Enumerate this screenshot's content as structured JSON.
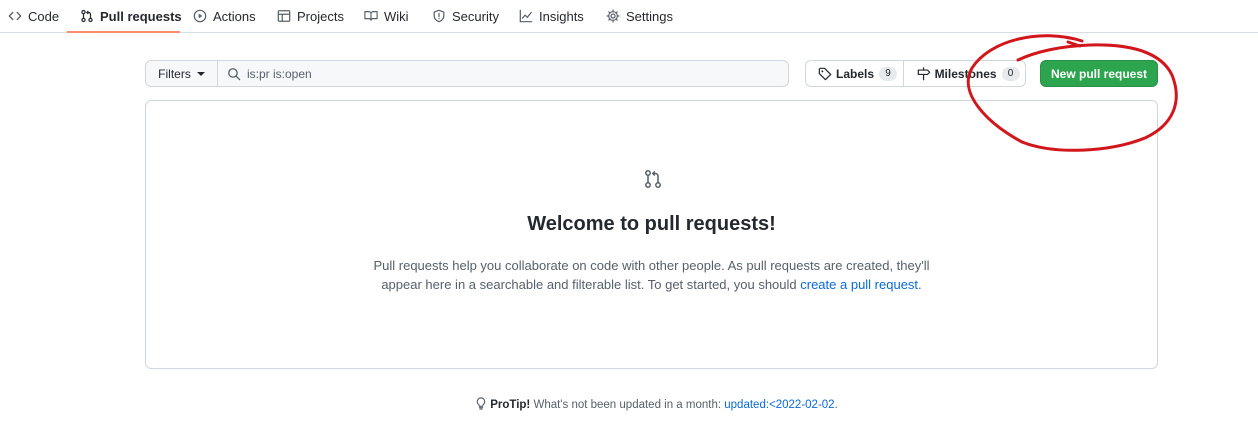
{
  "repo_nav": {
    "items": [
      {
        "label": "Code",
        "icon": "code-icon"
      },
      {
        "label": "Pull requests",
        "icon": "git-pull-request-icon"
      },
      {
        "label": "Actions",
        "icon": "play-icon"
      },
      {
        "label": "Projects",
        "icon": "table-icon"
      },
      {
        "label": "Wiki",
        "icon": "book-icon"
      },
      {
        "label": "Security",
        "icon": "shield-icon"
      },
      {
        "label": "Insights",
        "icon": "graph-icon"
      },
      {
        "label": "Settings",
        "icon": "gear-icon"
      }
    ],
    "selected": "Pull requests"
  },
  "filters": {
    "button_label": "Filters",
    "search_value": "is:pr is:open"
  },
  "labels": {
    "label": "Labels",
    "count": "9"
  },
  "milestones": {
    "label": "Milestones",
    "count": "0"
  },
  "new_pr_button": "New pull request",
  "blankslate": {
    "title": "Welcome to pull requests!",
    "text_line1": "Pull requests help you collaborate on code with other people. As pull requests are created, they'll",
    "text_line2_prefix": "appear here in a searchable and filterable list. To get started, you should ",
    "link_text": "create a pull request",
    "text_line2_suffix": "."
  },
  "protip": {
    "label": "ProTip!",
    "text": " What's not been updated in a month: ",
    "link_text": "updated:<2022-02-02",
    "suffix": "."
  },
  "colors": {
    "accent_underline": "#fd8c73",
    "primary_button": "#2da44e",
    "link": "#0969da",
    "annotation": "#d1171b"
  }
}
